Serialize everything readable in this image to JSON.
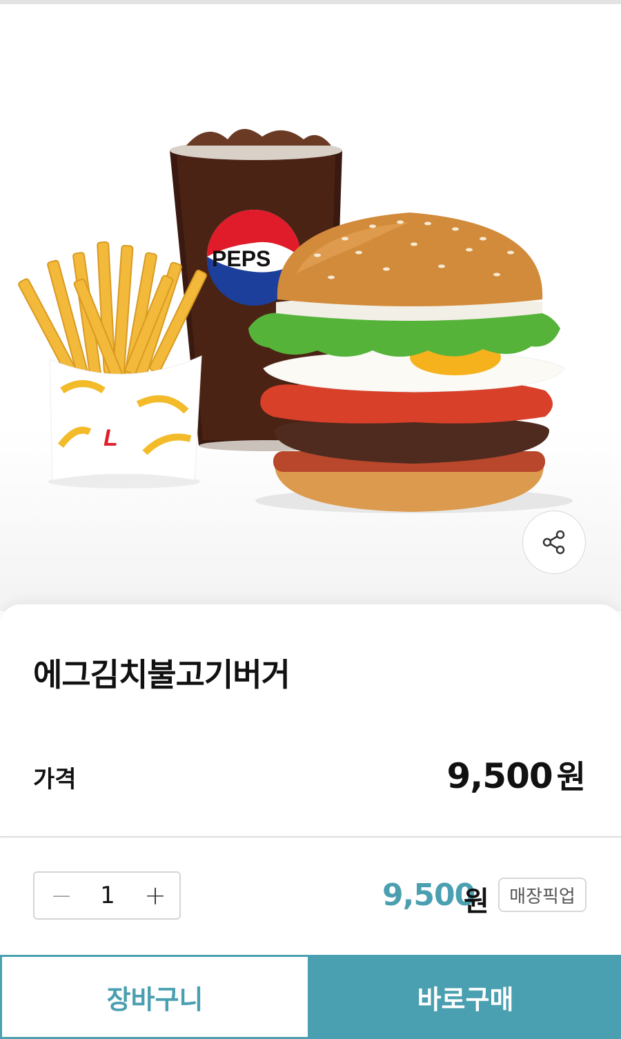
{
  "product": {
    "name": "에그김치불고기버거",
    "price_label": "가격",
    "price_value": "9,500",
    "price_unit": "원",
    "cup_brand_text": "PEPS",
    "fries_logo_text": "L"
  },
  "order": {
    "quantity": "1",
    "minus_symbol": "−",
    "plus_symbol": "+",
    "total_value": "9,500",
    "total_unit": "원",
    "pickup_label": "매장픽업"
  },
  "actions": {
    "cart_label": "장바구니",
    "buy_label": "바로구매"
  },
  "icons": {
    "share": "share-icon"
  },
  "colors": {
    "accent": "#4a9fb0",
    "text": "#111111",
    "border": "#d4d4d4"
  }
}
